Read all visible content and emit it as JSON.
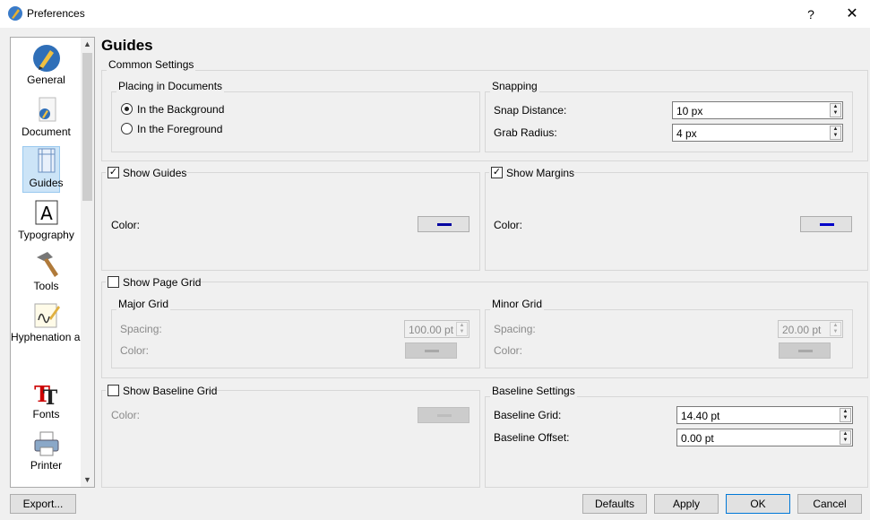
{
  "window": {
    "title": "Preferences",
    "help": "?",
    "close": "✕"
  },
  "sidebar": {
    "items": [
      {
        "label": "General",
        "icon": "pen-nib-icon"
      },
      {
        "label": "Document",
        "icon": "document-icon"
      },
      {
        "label": "Guides",
        "icon": "guides-icon"
      },
      {
        "label": "Typography",
        "icon": "letter-a-icon"
      },
      {
        "label": "Tools",
        "icon": "hammer-icon"
      },
      {
        "label": "Hyphenation and Spelling",
        "icon": "handwriting-icon"
      },
      {
        "label": "Fonts",
        "icon": "fonts-icon"
      },
      {
        "label": "Printer",
        "icon": "printer-icon"
      }
    ],
    "selected": "Guides"
  },
  "page": {
    "title": "Guides"
  },
  "common": {
    "title": "Common Settings",
    "placing": {
      "title": "Placing in Documents",
      "background": "In the Background",
      "foreground": "In the Foreground",
      "selected": "background"
    },
    "snapping": {
      "title": "Snapping",
      "snap_distance_label": "Snap Distance:",
      "snap_distance_value": "10 px",
      "grab_radius_label": "Grab Radius:",
      "grab_radius_value": "4 px"
    }
  },
  "show_guides": {
    "label": "Show Guides",
    "checked": true,
    "color_label": "Color:",
    "color": "#0000a0"
  },
  "show_margins": {
    "label": "Show Margins",
    "checked": true,
    "color_label": "Color:",
    "color": "#0000c8"
  },
  "page_grid": {
    "label": "Show Page Grid",
    "checked": false,
    "major": {
      "title": "Major Grid",
      "spacing_label": "Spacing:",
      "spacing_value": "100.00 pt",
      "color_label": "Color:"
    },
    "minor": {
      "title": "Minor Grid",
      "spacing_label": "Spacing:",
      "spacing_value": "20.00 pt",
      "color_label": "Color:"
    }
  },
  "baseline_grid": {
    "label": "Show Baseline Grid",
    "checked": false,
    "color_label": "Color:"
  },
  "baseline_settings": {
    "title": "Baseline Settings",
    "grid_label": "Baseline Grid:",
    "grid_value": "14.40 pt",
    "offset_label": "Baseline Offset:",
    "offset_value": "0.00 pt"
  },
  "buttons": {
    "export": "Export...",
    "defaults": "Defaults",
    "apply": "Apply",
    "ok": "OK",
    "cancel": "Cancel"
  },
  "colors": {
    "selection": "#cce4f7",
    "window_bg": "#f0f0f0"
  }
}
